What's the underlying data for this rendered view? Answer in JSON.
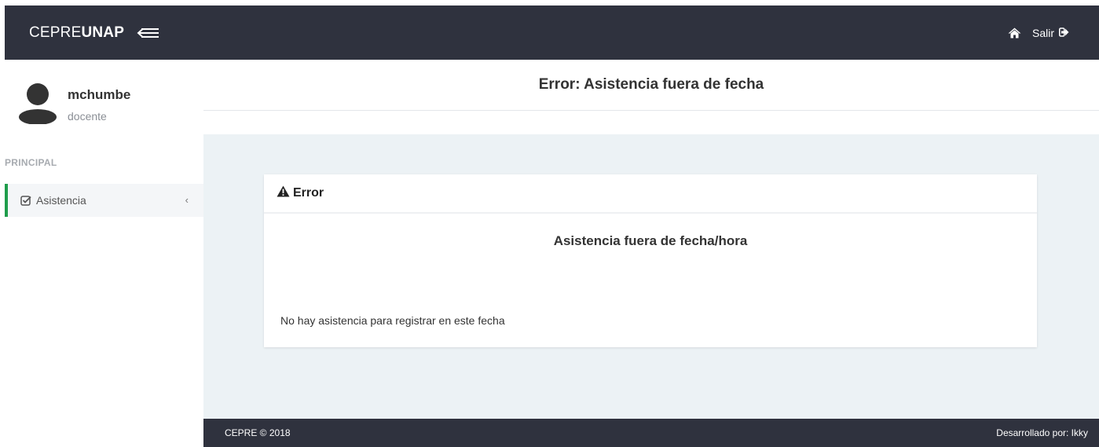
{
  "topbar": {
    "brand_light": "CEPRE",
    "brand_bold": "UNAP",
    "logout_label": "Salir"
  },
  "sidebar": {
    "user_name": "mchumbe",
    "user_role": "docente",
    "section_label": "PRINCIPAL",
    "items": [
      {
        "label": "Asistencia",
        "icon": "check-square-icon",
        "active": true
      }
    ]
  },
  "page": {
    "title": "Error: Asistencia fuera de fecha"
  },
  "panel": {
    "title": "Error",
    "subtitle": "Asistencia fuera de fecha/hora",
    "message": "No hay asistencia para registrar en este fecha"
  },
  "footer": {
    "left": "CEPRE © 2018",
    "right": "Desarrollado por: Ikky"
  },
  "colors": {
    "topbar_bg": "#2f323e",
    "main_bg": "#ecf2f5",
    "active_accent": "#1f9d4c"
  }
}
